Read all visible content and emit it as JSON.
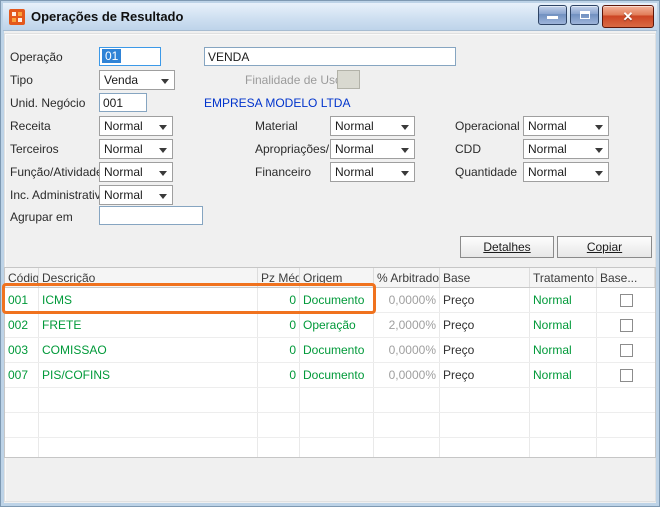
{
  "window": {
    "title": "Operações de Resultado",
    "controls": {
      "minimize": "minimize",
      "maximize": "maximize",
      "close": "✕"
    }
  },
  "form": {
    "operacao": {
      "label": "Operação",
      "code_value": "01",
      "name_value": "VENDA"
    },
    "tipo": {
      "label": "Tipo",
      "value": "Venda"
    },
    "finalidade_uso": {
      "label": "Finalidade de Uso",
      "value": ""
    },
    "unid_negocio": {
      "label": "Unid. Negócio",
      "value": "001"
    },
    "empresa": "EMPRESA MODELO LTDA",
    "receita": {
      "label": "Receita",
      "value": "Normal"
    },
    "material": {
      "label": "Material",
      "value": "Normal"
    },
    "operacional": {
      "label": "Operacional",
      "value": "Normal"
    },
    "terceiros": {
      "label": "Terceiros",
      "value": "Normal"
    },
    "apropriacoes_inv": {
      "label": "Apropriações/Inv.",
      "value": "Normal"
    },
    "cdd": {
      "label": "CDD",
      "value": "Normal"
    },
    "funcao_atividade": {
      "label": "Função/Atividade",
      "value": "Normal"
    },
    "financeiro": {
      "label": "Financeiro",
      "value": "Normal"
    },
    "quantidade": {
      "label": "Quantidade",
      "value": "Normal"
    },
    "inc_administrativa": {
      "label": "Inc. Administrativa",
      "value": "Normal"
    },
    "agrupar_em": {
      "label": "Agrupar em",
      "value": ""
    }
  },
  "buttons": {
    "detalhes": "Detalhes",
    "copiar": "Copiar"
  },
  "table": {
    "columns": [
      "Código",
      "Descrição",
      "Pz Médio",
      "Origem",
      "% Arbitrado",
      "Base",
      "Tratamento",
      "Base..."
    ],
    "rows": [
      {
        "codigo": "001",
        "descricao": "ICMS",
        "pz_medio": "0",
        "origem": "Documento",
        "arbitrado": "0,0000%",
        "base": "Preço",
        "tratamento": "Normal",
        "checked": false
      },
      {
        "codigo": "002",
        "descricao": "FRETE",
        "pz_medio": "0",
        "origem": "Operação",
        "arbitrado": "2,0000%",
        "base": "Preço",
        "tratamento": "Normal",
        "checked": false
      },
      {
        "codigo": "003",
        "descricao": "COMISSAO",
        "pz_medio": "0",
        "origem": "Documento",
        "arbitrado": "0,0000%",
        "base": "Preço",
        "tratamento": "Normal",
        "checked": false
      },
      {
        "codigo": "007",
        "descricao": "PIS/COFINS",
        "pz_medio": "0",
        "origem": "Documento",
        "arbitrado": "0,0000%",
        "base": "Preço",
        "tratamento": "Normal",
        "checked": false
      }
    ],
    "empty_rows": 3
  },
  "annotation": {
    "type": "highlight-box",
    "highlighted_row": "001 ICMS"
  },
  "colors": {
    "grid_value_green": "#009939",
    "arbitrado_gray": "#9F9F9F",
    "empresa_blue": "#0033CC",
    "annotation_orange": "#F0721E",
    "titlebar_blue": "#CFE0F1",
    "close_button_red": "#CC4423"
  }
}
